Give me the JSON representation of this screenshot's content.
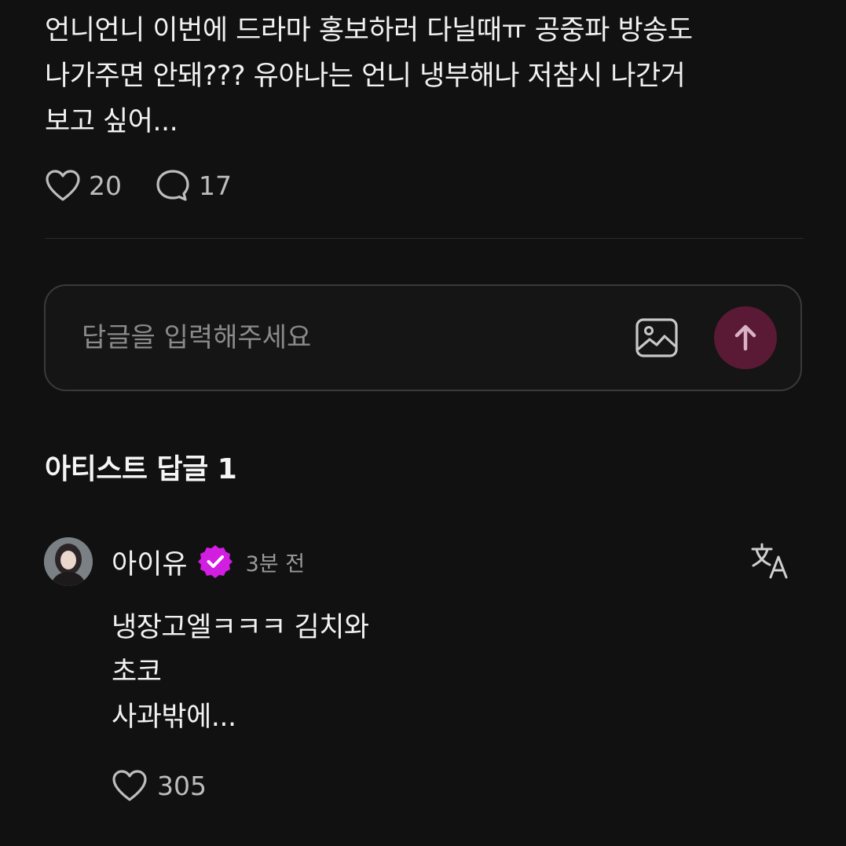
{
  "post": {
    "text": "언니언니 이번에 드라마 홍보하러 다닐때ㅠ 공중파 방송도\n나가주면 안돼??? 유야나는 언니 냉부해나 저참시 나간거\n보고 싶어...",
    "likes": "20",
    "comments": "17"
  },
  "reply_box": {
    "placeholder": "답글을 입력해주세요"
  },
  "artist_replies": {
    "title": "아티스트 답글 1"
  },
  "comment": {
    "author": "아이유",
    "time": "3분 전",
    "text": "냉장고엘ㅋㅋㅋ 김치와\n초코\n사과밖에...",
    "likes": "305"
  },
  "icons": {
    "like": "heart-outline-icon",
    "comment": "speech-bubble-icon",
    "image": "image-icon",
    "send": "arrow-up-icon",
    "verified": "verified-badge-icon",
    "translate": "translate-icon"
  },
  "colors": {
    "background": "#111111",
    "send_button": "#5a1a35",
    "verified_badge": "#d21ee0"
  }
}
